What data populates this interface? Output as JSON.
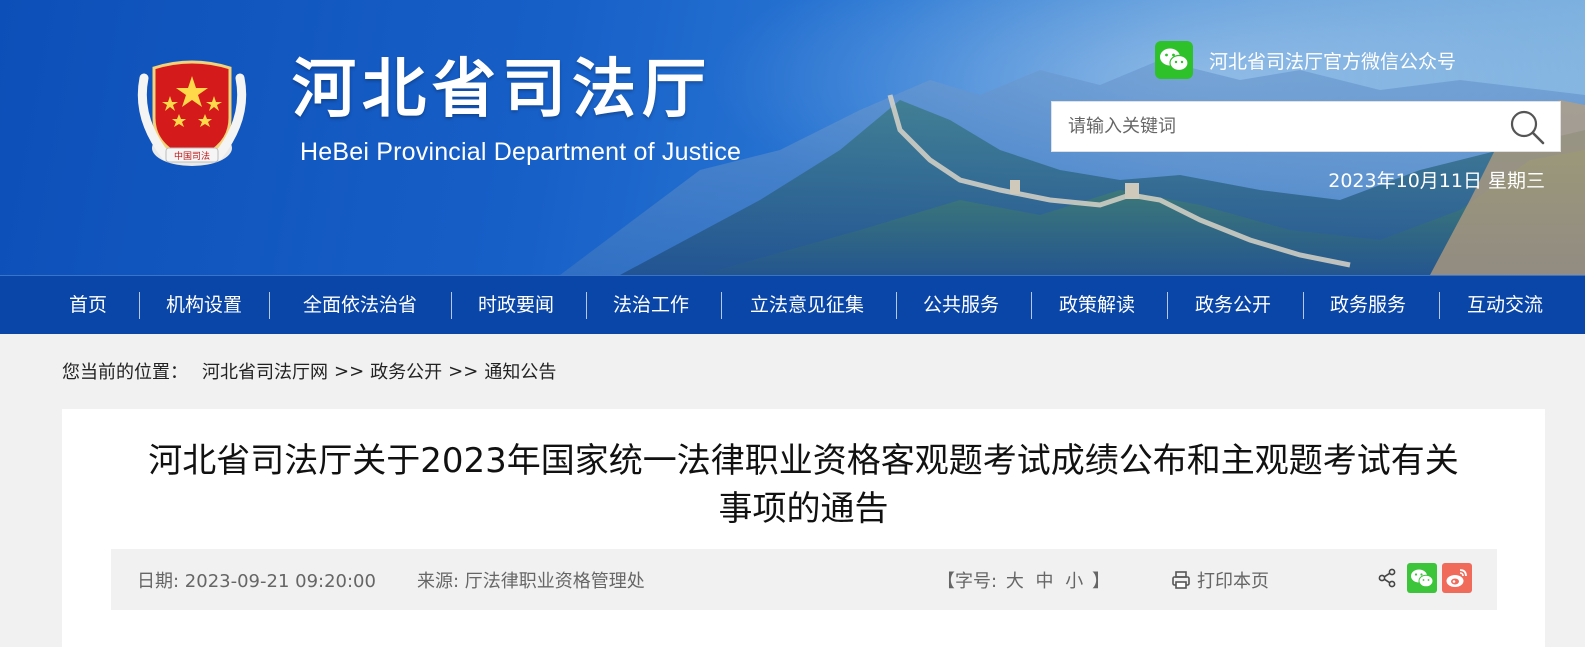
{
  "header": {
    "title_cn": "河北省司法厅",
    "title_en": "HeBei Provincial Department of Justice",
    "emblem_text": "中国司法",
    "wechat_label": "河北省司法厅官方微信公众号",
    "search_placeholder": "请输入关键词",
    "date": "2023年10月11日 星期三"
  },
  "nav": {
    "items": [
      {
        "label": "首页"
      },
      {
        "label": "机构设置"
      },
      {
        "label": "全面依法治省"
      },
      {
        "label": "时政要闻"
      },
      {
        "label": "法治工作"
      },
      {
        "label": "立法意见征集"
      },
      {
        "label": "公共服务"
      },
      {
        "label": "政策解读"
      },
      {
        "label": "政务公开"
      },
      {
        "label": "政务服务"
      },
      {
        "label": "互动交流"
      }
    ]
  },
  "breadcrumb": {
    "prefix": "您当前的位置：",
    "items": [
      "河北省司法厅网",
      "政务公开",
      "通知公告"
    ],
    "separator": ">>"
  },
  "article": {
    "title_line1": "河北省司法厅关于2023年国家统一法律职业资格客观题考试成绩公布和主观题考试有关",
    "title_line2": "事项的通告",
    "date": "日期: 2023-09-21 09:20:00",
    "source": "来源: 厅法律职业资格管理处",
    "font_open": "【字号:",
    "font_large": "大",
    "font_medium": "中",
    "font_small": "小",
    "font_close": "】",
    "print_label": "打印本页"
  },
  "colors": {
    "nav_bg": "#0a46a8",
    "wechat_green": "#2ec12a",
    "weibo_red": "#f06b5a"
  },
  "icons": [
    "wechat-icon",
    "search-icon",
    "print-icon",
    "share-icon",
    "weibo-icon"
  ]
}
